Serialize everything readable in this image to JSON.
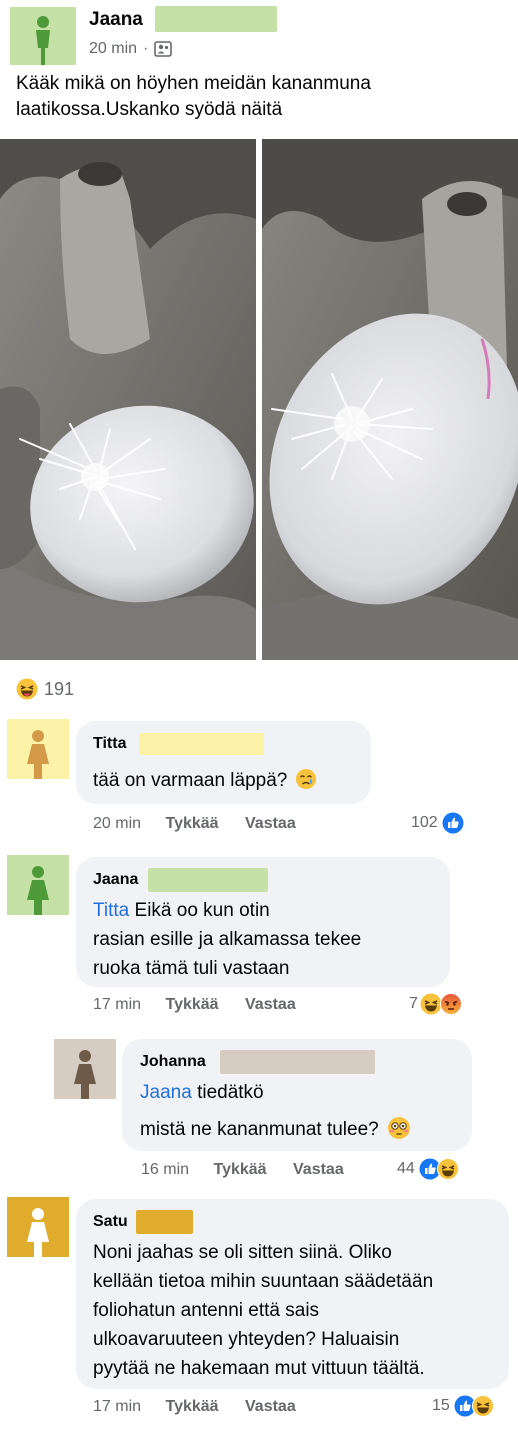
{
  "post": {
    "author": "Jaana",
    "time": "20 min",
    "audience_separator": "·",
    "audience_icon": "friends-icon",
    "text": "Kääk mikä on höyhen meidän kananmuna laatikossa.Uskanko syödä näitä",
    "reaction_icon": "haha-reaction-icon",
    "reaction_count": "191"
  },
  "colors": {
    "avatar_green": "#c5e1a6",
    "avatar_yellow": "#fdf3a8",
    "avatar_taupe": "#d6ccc2",
    "avatar_gold": "#e0ac2d",
    "like_blue": "#1877f2",
    "tag_blue": "#216fdb",
    "bubble": "#f0f2f5"
  },
  "comments": [
    {
      "name": "Titta",
      "text": "tää on varmaan läppä?",
      "emoji_icon": "crying-face-icon",
      "time": "20 min",
      "like": "Tykkää",
      "reply": "Vastaa",
      "count": "102",
      "reactions": [
        "like-reaction-icon"
      ]
    },
    {
      "name": "Jaana",
      "tag": "Titta",
      "text_line1": "Eikä oo kun otin",
      "text_line2": "rasian esille ja alkamassa tekee",
      "text_line3": "ruoka tämä tuli vastaan",
      "time": "17 min",
      "like": "Tykkää",
      "reply": "Vastaa",
      "count": "7",
      "reactions": [
        "haha-reaction-icon",
        "angry-reaction-icon"
      ]
    },
    {
      "name": "Johanna",
      "tag": "Jaana",
      "text_line1": "tiedätkö",
      "text_line2": "mistä ne kananmunat tulee?",
      "emoji_icon": "flushed-face-icon",
      "time": "16 min",
      "like": "Tykkää",
      "reply": "Vastaa",
      "count": "44",
      "reactions": [
        "like-reaction-icon",
        "haha-reaction-icon"
      ]
    },
    {
      "name": "Satu",
      "text_line1": "Noni jaahas se oli sitten siinä. Oliko",
      "text_line2": "kellään tietoa mihin suuntaan säädetään",
      "text_line3": "foliohatun antenni että sais",
      "text_line4": "ulkoavaruuteen yhteyden? Haluaisin",
      "text_line5": "pyytää ne hakemaan mut vittuun täältä.",
      "time": "17 min",
      "like": "Tykkää",
      "reply": "Vastaa",
      "count": "15",
      "reactions": [
        "like-reaction-icon",
        "haha-reaction-icon"
      ]
    }
  ]
}
